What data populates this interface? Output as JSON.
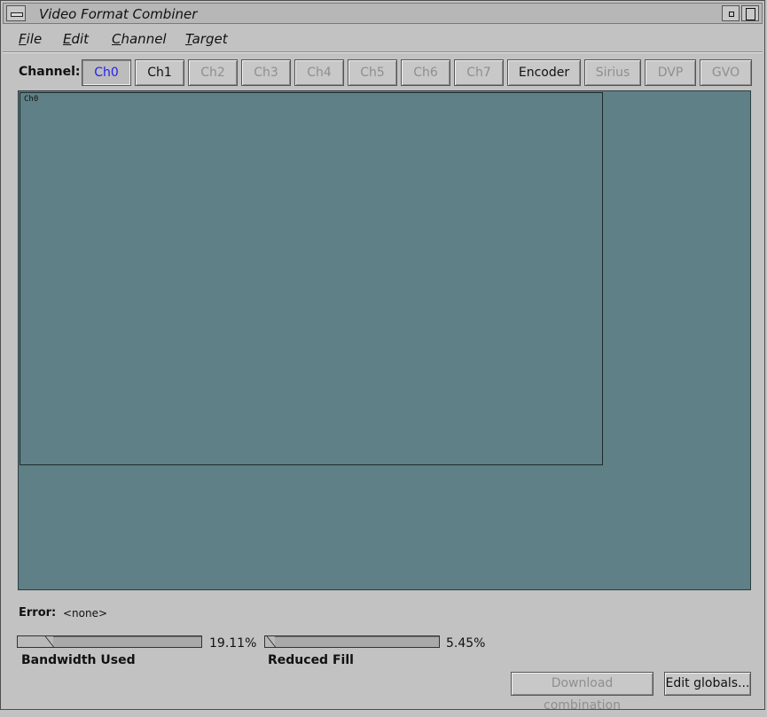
{
  "window": {
    "title": "Video Format Combiner"
  },
  "menubar": {
    "items": [
      "File",
      "Edit",
      "Channel",
      "Target"
    ]
  },
  "channel_row": {
    "label": "Channel:",
    "buttons": [
      {
        "label": "Ch0",
        "state": "selected"
      },
      {
        "label": "Ch1",
        "state": "enabled"
      },
      {
        "label": "Ch2",
        "state": "disabled"
      },
      {
        "label": "Ch3",
        "state": "disabled"
      },
      {
        "label": "Ch4",
        "state": "disabled"
      },
      {
        "label": "Ch5",
        "state": "disabled"
      },
      {
        "label": "Ch6",
        "state": "disabled"
      },
      {
        "label": "Ch7",
        "state": "disabled"
      },
      {
        "label": "Encoder",
        "state": "enabled"
      },
      {
        "label": "Sirius",
        "state": "disabled"
      },
      {
        "label": "DVP",
        "state": "disabled"
      },
      {
        "label": "GVO",
        "state": "disabled"
      }
    ]
  },
  "canvas": {
    "background_color": "#5e8086",
    "channel_label": "Ch0"
  },
  "error": {
    "label": "Error:",
    "value": "<none>"
  },
  "gauges": {
    "bandwidth": {
      "caption": "Bandwidth Used",
      "value_text": "19.11%",
      "fraction": 0.1911
    },
    "fill": {
      "caption": "Reduced Fill",
      "value_text": "5.45%",
      "fraction": 0.0545
    }
  },
  "buttons": {
    "download": {
      "label": "Download combination",
      "state": "disabled"
    },
    "edit_globals": {
      "label": "Edit globals...",
      "state": "enabled"
    }
  },
  "colors": {
    "selected_text": "#2222ee",
    "disabled_text": "#8f8f8f"
  }
}
